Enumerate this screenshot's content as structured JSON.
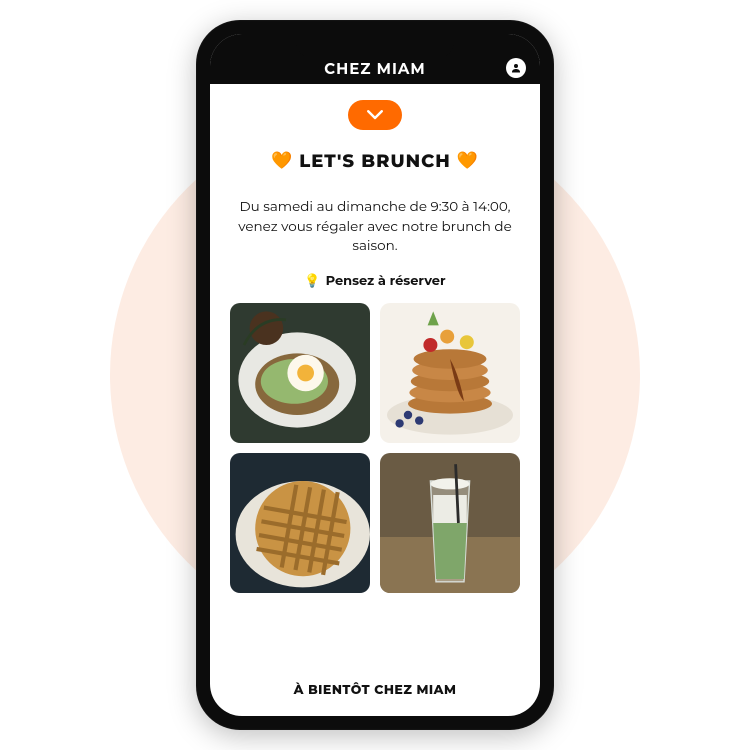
{
  "header": {
    "title": "CHEZ MIAM"
  },
  "collapse": {
    "label": "collapse"
  },
  "section": {
    "title": "LET'S BRUNCH",
    "heart_icon": "🧡",
    "description": "Du samedi au dimanche de 9:30 à 14:00, venez vous régaler avec notre brunch de saison.",
    "cta_icon": "💡",
    "cta": "Pensez à réserver"
  },
  "gallery": {
    "item1": "avocado-toast-poached-egg",
    "item2": "pancake-stack-fruit",
    "item3": "waffles",
    "item4": "matcha-latte"
  },
  "footer": {
    "text": "À BIENTÔT CHEZ MIAM"
  },
  "colors": {
    "accent": "#ff6a00",
    "heart": "#ff8c1a"
  }
}
